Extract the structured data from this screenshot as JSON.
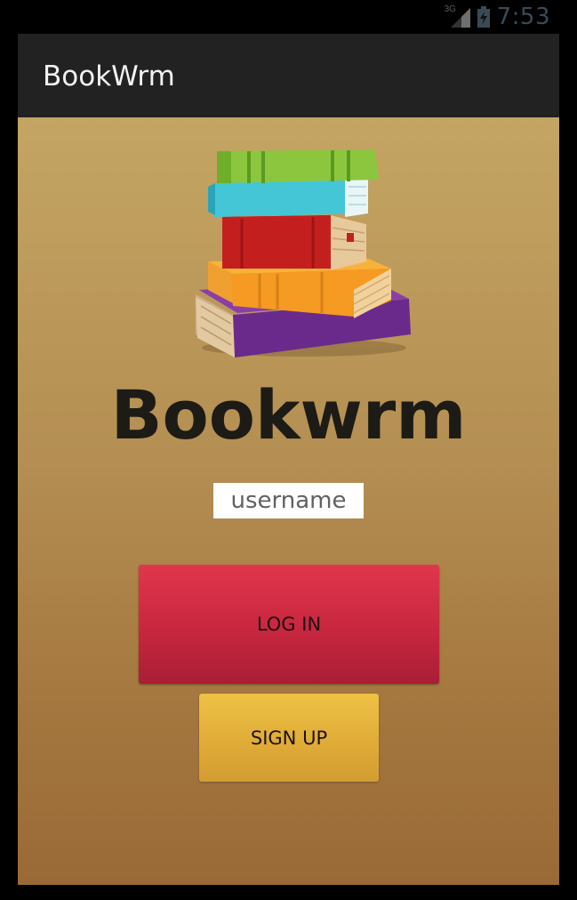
{
  "status_bar": {
    "network_type": "3G",
    "time": "7:53",
    "signal_icon": "cell-signal-icon",
    "battery_icon": "battery-charging-icon",
    "clock_color": "#3a4a55"
  },
  "action_bar": {
    "title": "BookWrm",
    "background": "#222222"
  },
  "main": {
    "logo_icon": "book-stack-icon",
    "brand_title": "Bookwrm",
    "username": {
      "placeholder": "username",
      "value": ""
    },
    "login_label": "LOG IN",
    "signup_label": "SIGN UP",
    "login_color": "#d32f45",
    "signup_color": "#e4b23c"
  }
}
